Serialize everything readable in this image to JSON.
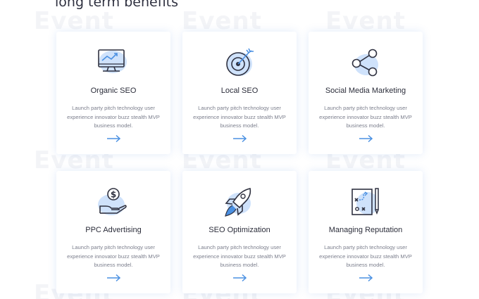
{
  "section": {
    "heading": "long term benefits"
  },
  "watermark_text": "Event",
  "colors": {
    "accent": "#4a90e2",
    "blob": "#cfe2fb",
    "icon_stroke": "#2f3140",
    "description": "#7c7f8d"
  },
  "cards": [
    {
      "icon": "monitor-chart-icon",
      "title": "Organic SEO",
      "description": "Launch party pitch technology user experience innovator buzz stealth MVP business model.",
      "arrow": "right-arrow-icon"
    },
    {
      "icon": "target-dart-icon",
      "title": "Local SEO",
      "description": "Launch party pitch technology user experience innovator buzz stealth MVP business model.",
      "arrow": "right-arrow-icon"
    },
    {
      "icon": "share-nodes-icon",
      "title": "Social Media Marketing",
      "description": "Launch party pitch technology user experience innovator buzz stealth MVP business model.",
      "arrow": "right-arrow-icon"
    },
    {
      "icon": "hand-dollar-icon",
      "title": "PPC Advertising",
      "description": "Launch party pitch technology user experience innovator buzz stealth MVP business model.",
      "arrow": "right-arrow-icon"
    },
    {
      "icon": "rocket-icon",
      "title": "SEO Optimization",
      "description": "Launch party pitch technology user experience innovator buzz stealth MVP business model.",
      "arrow": "right-arrow-icon"
    },
    {
      "icon": "strategy-board-icon",
      "title": "Managing Reputation",
      "description": "Launch party pitch technology user experience innovator buzz stealth MVP business model.",
      "arrow": "right-arrow-icon"
    }
  ]
}
